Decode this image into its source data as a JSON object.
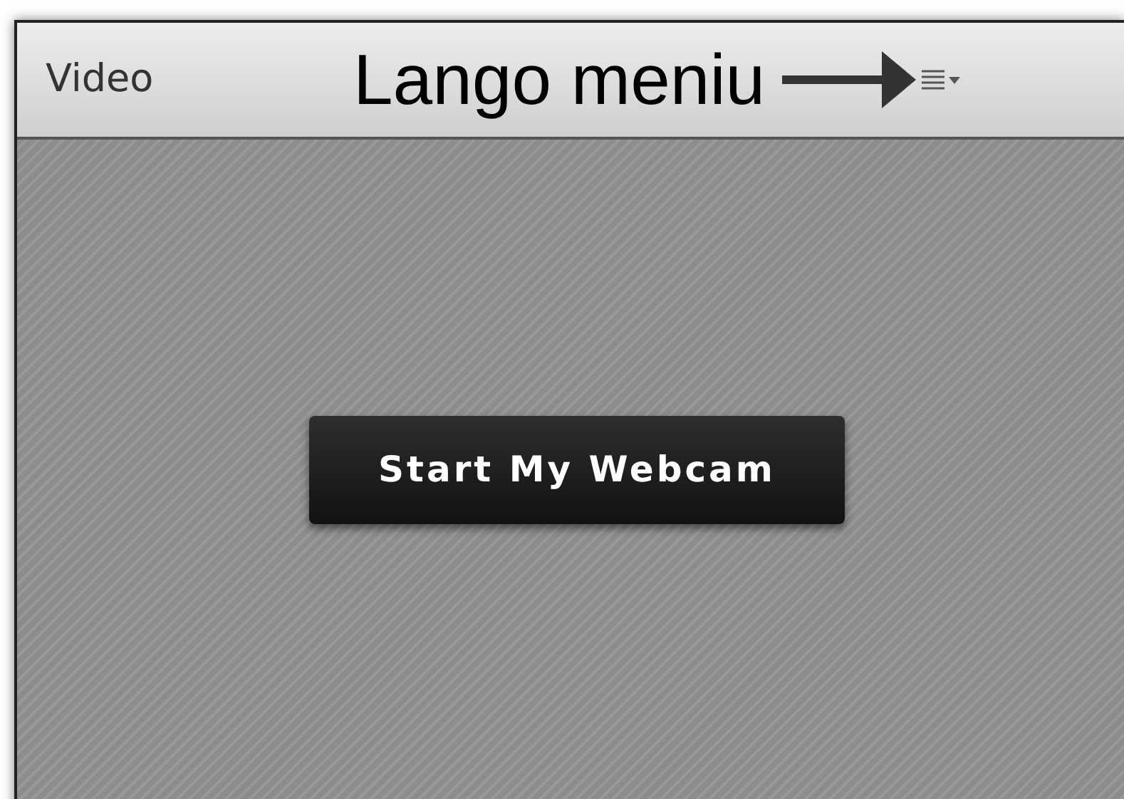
{
  "panel": {
    "title": "Video"
  },
  "annotation": {
    "text": "Lango meniu"
  },
  "button": {
    "label": "Start My Webcam"
  }
}
